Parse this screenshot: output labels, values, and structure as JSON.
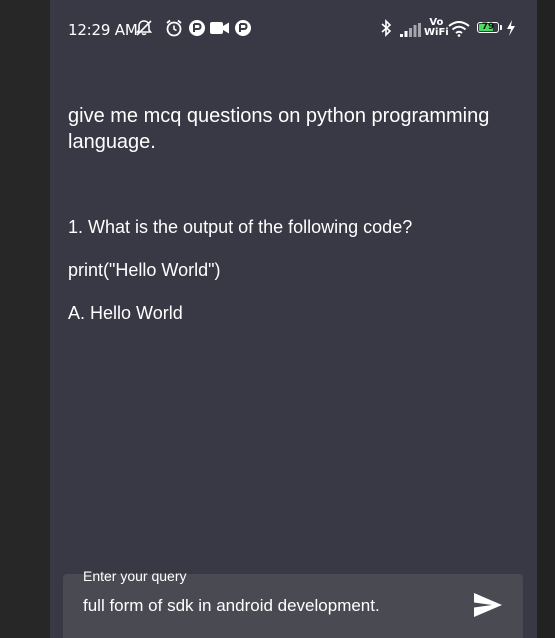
{
  "status_bar": {
    "time": "12:29 AM",
    "network_label_top": "Vo",
    "network_label_bottom": "WiFi",
    "battery_level": "79",
    "battery_percent": 79,
    "battery_color": "#4cd964"
  },
  "icons": {
    "muted": "notifications-off-icon",
    "alarm": "alarm-icon",
    "app1": "app-notification-icon",
    "camera": "video-camera-icon",
    "app2": "app-notification-icon",
    "bluetooth": "bluetooth-icon",
    "signal": "cellular-signal-icon",
    "wifi": "wifi-icon",
    "battery": "battery-icon",
    "charging": "charging-icon",
    "send": "send-icon"
  },
  "chat": {
    "query": "give me mcq questions on python programming language.",
    "response_lines": [
      "1. What is the output of the following code?",
      "print(\"Hello World\")",
      "A. Hello World"
    ]
  },
  "input": {
    "label": "Enter your query",
    "value": "full form of sdk in android development."
  },
  "theme": {
    "background": "#393845",
    "input_background": "#4a4a53",
    "text": "#ffffff"
  }
}
